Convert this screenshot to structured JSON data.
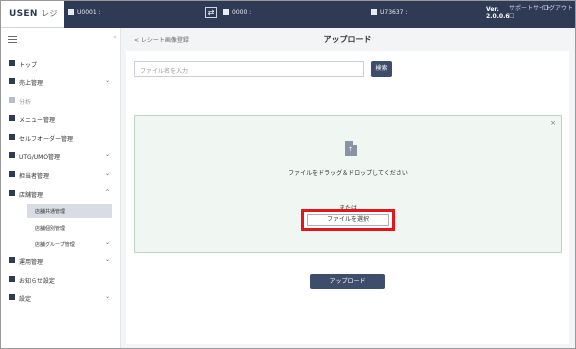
{
  "topbar": {
    "brand": "USEN",
    "brand_sub": "レジ",
    "account": "U0001 :",
    "store": "0000 :",
    "user": "U73637 :",
    "version_label": "Ver.",
    "version": "2.0.0.6",
    "support": "サポートサイト",
    "logout": "ログアウト"
  },
  "sidebar": {
    "items": [
      {
        "label": "トップ",
        "chevron": ""
      },
      {
        "label": "売上管理",
        "chevron": "⌄"
      },
      {
        "label": "分析",
        "chevron": ""
      },
      {
        "label": "メニュー管理",
        "chevron": ""
      },
      {
        "label": "セルフオーダー管理",
        "chevron": ""
      },
      {
        "label": "UTG/UMO管理",
        "chevron": "⌄"
      },
      {
        "label": "担当者管理",
        "chevron": "⌄"
      },
      {
        "label": "店舗管理",
        "chevron": "^"
      }
    ],
    "subitems": [
      {
        "label": "店舗共通管理"
      },
      {
        "label": "店舗個別管理"
      },
      {
        "label": "店舗グループ管理",
        "chevron": "⌄"
      }
    ],
    "bottom_items": [
      {
        "label": "運用管理",
        "chevron": "⌄"
      },
      {
        "label": "お知らせ設定",
        "chevron": ""
      },
      {
        "label": "設定",
        "chevron": "⌄"
      }
    ]
  },
  "main": {
    "back_link": "< レシート画像登録",
    "title": "アップロード",
    "search_placeholder": "ファイル名を入力",
    "search_button": "検索",
    "drop_text": "ファイルをドラッグ＆ドロップしてください",
    "or_text": "または",
    "select_button": "ファイルを選択",
    "upload_button": "アップロード"
  },
  "colors": {
    "topbar": "#2f3b55",
    "accent_button": "#3d4d6b",
    "highlight_border": "#e6151c",
    "dropzone_bg": "#f0f6f2"
  }
}
